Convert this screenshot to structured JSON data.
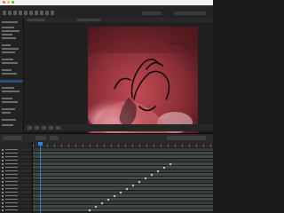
{
  "app": {
    "name": "After Effects"
  },
  "colors": {
    "accent": "#2e7de0",
    "canvas_bg": "#7a2a30",
    "track": "#3f4a45",
    "track_alt": "#3a3a3a",
    "selection": "#2b4d7a"
  },
  "icons": {
    "window_controls": [
      "close-icon",
      "minimize-icon",
      "zoom-icon"
    ],
    "toolbar_tools": [
      "home-icon",
      "select-tool-icon",
      "hand-tool-icon",
      "zoom-tool-icon",
      "camera-tool-icon",
      "pan-behind-icon",
      "rect-mask-icon",
      "pen-tool-icon",
      "text-tool-icon",
      "brush-tool-icon"
    ],
    "viewer_controls": [
      "magnify-icon",
      "resolution-icon",
      "grid-icon",
      "mask-toggle-icon",
      "camera-icon"
    ]
  },
  "timeline": {
    "layer_count": 18,
    "playhead_fraction": 0.04
  }
}
